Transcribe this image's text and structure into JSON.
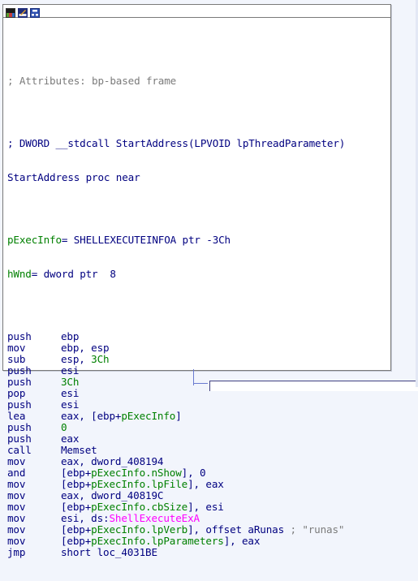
{
  "window": {
    "buttons": [
      {
        "icon": "color-palette-icon"
      },
      {
        "icon": "rename-pencil-icon"
      },
      {
        "icon": "graph-view-icon"
      }
    ]
  },
  "header_comments": [
    "; Attributes: bp-based frame",
    "; DWORD __stdcall StartAddress(LPVOID lpThreadParameter)"
  ],
  "proc_line": "StartAddress proc near",
  "locals": [
    {
      "name": "pExecInfo",
      "rest": "= SHELLEXECUTEINFOA ptr -3Ch"
    },
    {
      "name": "hWnd",
      "rest": "= dword ptr  8"
    }
  ],
  "instructions": [
    {
      "mnemonic": "push",
      "ops": [
        {
          "t": "ebp",
          "c": "blue"
        }
      ]
    },
    {
      "mnemonic": "mov",
      "ops": [
        {
          "t": "ebp, esp",
          "c": "blue"
        }
      ]
    },
    {
      "mnemonic": "sub",
      "ops": [
        {
          "t": "esp, ",
          "c": "blue"
        },
        {
          "t": "3Ch",
          "c": "green"
        }
      ]
    },
    {
      "mnemonic": "push",
      "ops": [
        {
          "t": "esi",
          "c": "blue"
        }
      ]
    },
    {
      "mnemonic": "push",
      "ops": [
        {
          "t": "3Ch",
          "c": "green"
        }
      ]
    },
    {
      "mnemonic": "pop",
      "ops": [
        {
          "t": "esi",
          "c": "blue"
        }
      ]
    },
    {
      "mnemonic": "push",
      "ops": [
        {
          "t": "esi",
          "c": "blue"
        }
      ]
    },
    {
      "mnemonic": "lea",
      "ops": [
        {
          "t": "eax, [ebp+",
          "c": "blue"
        },
        {
          "t": "pExecInfo",
          "c": "green"
        },
        {
          "t": "]",
          "c": "blue"
        }
      ]
    },
    {
      "mnemonic": "push",
      "ops": [
        {
          "t": "0",
          "c": "green"
        }
      ]
    },
    {
      "mnemonic": "push",
      "ops": [
        {
          "t": "eax",
          "c": "blue"
        }
      ]
    },
    {
      "mnemonic": "call",
      "ops": [
        {
          "t": "Memset",
          "c": "blue"
        }
      ]
    },
    {
      "mnemonic": "mov",
      "ops": [
        {
          "t": "eax, dword_408194",
          "c": "blue"
        }
      ]
    },
    {
      "mnemonic": "and",
      "ops": [
        {
          "t": "[ebp+",
          "c": "blue"
        },
        {
          "t": "pExecInfo.nShow",
          "c": "green"
        },
        {
          "t": "], 0",
          "c": "blue"
        }
      ]
    },
    {
      "mnemonic": "mov",
      "ops": [
        {
          "t": "[ebp+",
          "c": "blue"
        },
        {
          "t": "pExecInfo.lpFile",
          "c": "green"
        },
        {
          "t": "], eax",
          "c": "blue"
        }
      ]
    },
    {
      "mnemonic": "mov",
      "ops": [
        {
          "t": "eax, dword_40819C",
          "c": "blue"
        }
      ]
    },
    {
      "mnemonic": "mov",
      "ops": [
        {
          "t": "[ebp+",
          "c": "blue"
        },
        {
          "t": "pExecInfo.cbSize",
          "c": "green"
        },
        {
          "t": "], esi",
          "c": "blue"
        }
      ]
    },
    {
      "mnemonic": "mov",
      "ops": [
        {
          "t": "esi, ds:",
          "c": "blue"
        },
        {
          "t": "ShellExecuteExA",
          "c": "pink"
        }
      ]
    },
    {
      "mnemonic": "mov",
      "ops": [
        {
          "t": "[ebp+",
          "c": "blue"
        },
        {
          "t": "pExecInfo.lpVerb",
          "c": "green"
        },
        {
          "t": "], offset aRunas ",
          "c": "blue"
        },
        {
          "t": "; \"runas\"",
          "c": "comment"
        }
      ]
    },
    {
      "mnemonic": "mov",
      "ops": [
        {
          "t": "[ebp+",
          "c": "blue"
        },
        {
          "t": "pExecInfo.lpParameters",
          "c": "green"
        },
        {
          "t": "], eax",
          "c": "blue"
        }
      ]
    },
    {
      "mnemonic": "jmp",
      "ops": [
        {
          "t": "short loc_4031BE",
          "c": "blue"
        }
      ]
    }
  ],
  "colors": {
    "comment": "#7b7b7b",
    "instruction": "#000080",
    "variable": "#008000",
    "import": "#ff00ff",
    "background": "#f2f5fc",
    "edge": "#6a7bd0"
  }
}
